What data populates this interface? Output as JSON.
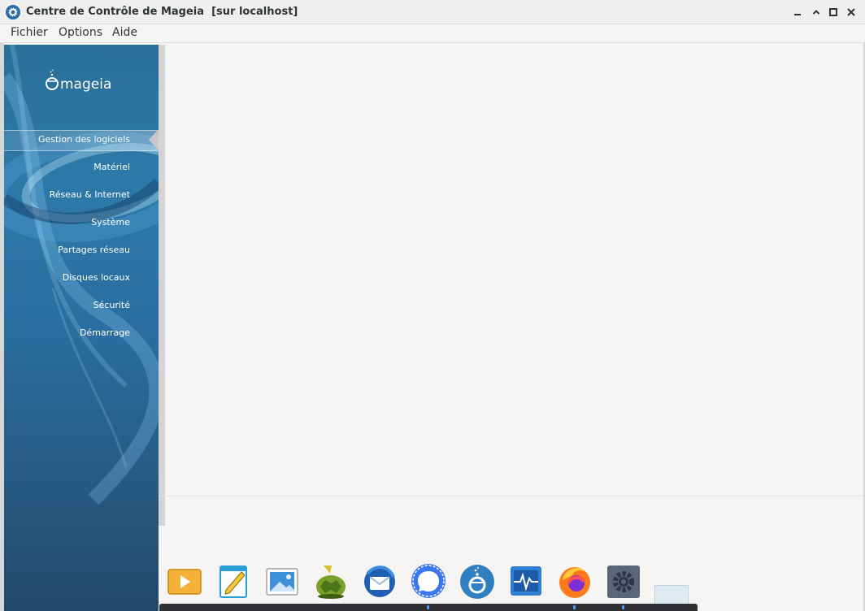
{
  "window": {
    "title": "Centre de Contrôle de Mageia  [sur localhost]",
    "controls": [
      "minimize",
      "maximize",
      "close"
    ]
  },
  "menubar": {
    "items": [
      "Fichier",
      "Options",
      "Aide"
    ]
  },
  "sidebar": {
    "logo_text": "mageia",
    "selected_index": 0,
    "items": [
      {
        "label": "Gestion des logiciels"
      },
      {
        "label": "Matériel"
      },
      {
        "label": "Réseau & Internet"
      },
      {
        "label": "Système"
      },
      {
        "label": "Partages réseau"
      },
      {
        "label": "Disques locaux"
      },
      {
        "label": "Sécurité"
      },
      {
        "label": "Démarrage"
      }
    ]
  },
  "dock": {
    "icons": [
      {
        "name": "media-player-icon"
      },
      {
        "name": "text-editor-icon"
      },
      {
        "name": "image-viewer-icon"
      },
      {
        "name": "turtle-icon"
      },
      {
        "name": "thunderbird-icon"
      },
      {
        "name": "signal-icon"
      },
      {
        "name": "mageia-control-center-icon"
      },
      {
        "name": "system-monitor-icon"
      },
      {
        "name": "firefox-icon"
      },
      {
        "name": "settings-icon"
      }
    ]
  },
  "colors": {
    "sidebar_top": "#2c79a8",
    "sidebar_bottom": "#23486a",
    "window_bg": "#f6f5f4",
    "accent": "#4a9eff"
  }
}
